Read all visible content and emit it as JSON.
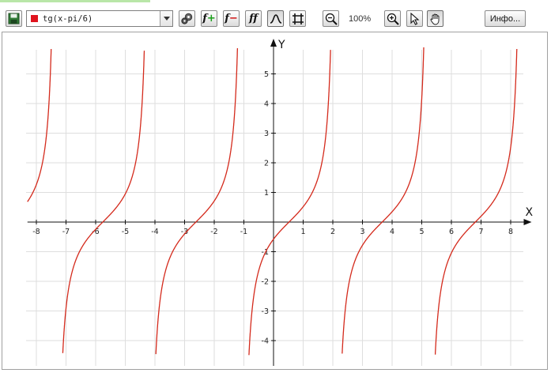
{
  "toolbar": {
    "function_select": {
      "value": "tg(x-pi/6)",
      "color": "#e0141e"
    },
    "zoom_label": "100%",
    "info_label": "Инфо...",
    "buttons": [
      {
        "name": "save-icon"
      },
      {
        "name": "settings-gears-icon"
      },
      {
        "name": "add-function-icon"
      },
      {
        "name": "remove-function-icon"
      },
      {
        "name": "functions-list-icon"
      },
      {
        "name": "curve-mode-icon",
        "active": true
      },
      {
        "name": "grid-toggle-icon"
      },
      {
        "name": "zoom-out-icon"
      },
      {
        "name": "zoom-in-icon"
      },
      {
        "name": "pointer-tool-icon"
      },
      {
        "name": "pan-hand-icon",
        "active": true
      }
    ]
  },
  "chart_data": {
    "type": "line",
    "function": "tg(x-pi/6)",
    "xlabel": "X",
    "ylabel": "Y",
    "xlim": [
      -8.3,
      8.6
    ],
    "ylim": [
      -4.5,
      5.9
    ],
    "x_ticks": [
      "-8",
      "-7",
      "-6",
      "-5",
      "-4",
      "-3",
      "-2",
      "-1",
      "1",
      "2",
      "3",
      "4",
      "5",
      "6",
      "7",
      "8"
    ],
    "y_ticks": [
      "-4",
      "-3",
      "-2",
      "-1",
      "1",
      "2",
      "3",
      "4",
      "5"
    ],
    "grid": true,
    "line_color": "#d42a1c"
  }
}
